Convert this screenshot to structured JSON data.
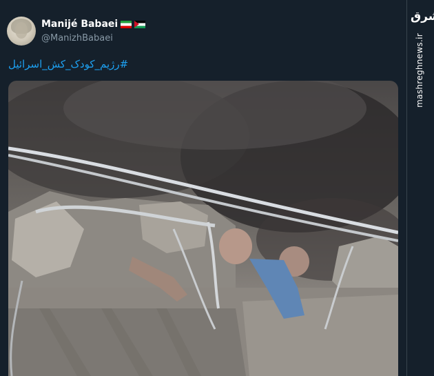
{
  "tweet": {
    "author_name": "Manijé Babaei",
    "author_handle": "@ManizhBabaei",
    "flags": [
      "iran-flag-icon",
      "palestine-flag-icon"
    ],
    "hashtag": "#رژیم_کودک_کش_اسرائیل",
    "avatar_icon": "avatar-photo",
    "media_description_icon": "tweet-photo"
  },
  "watermark": {
    "logo_text": "مشرق",
    "url": "mashreghnews.ir"
  },
  "colors": {
    "background": "#15202b",
    "name": "#ffffff",
    "handle": "#8899a6",
    "hashtag": "#1da1f2"
  }
}
